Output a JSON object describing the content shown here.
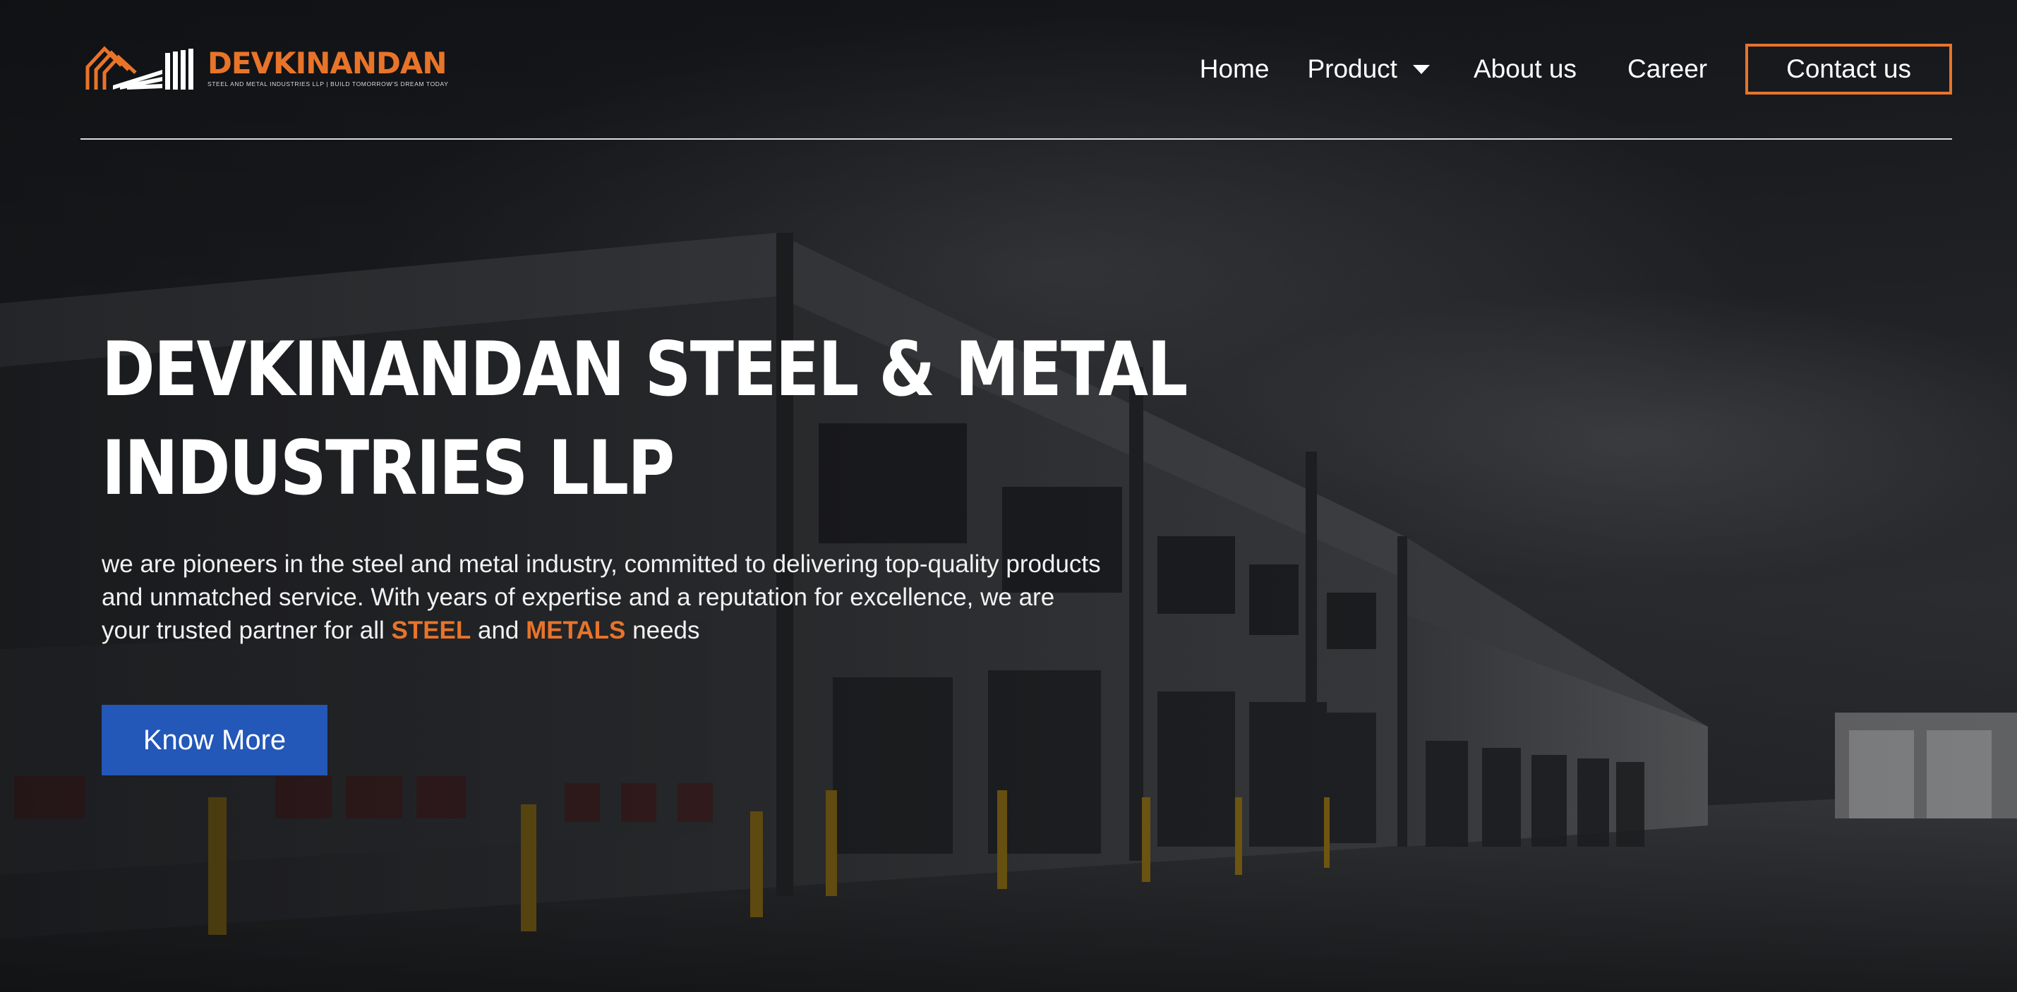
{
  "brand": {
    "name": "DEVKINANDAN",
    "tagline": "STEEL AND METAL INDUSTRIES LLP | BUILD TOMORROW'S DREAM TODAY",
    "accent_color": "#e8742a"
  },
  "nav": {
    "home": "Home",
    "product": "Product",
    "about": "About us",
    "career": "Career",
    "contact": "Contact us"
  },
  "hero": {
    "title_line1": "DEVKINANDAN STEEL & METAL",
    "title_line2": "INDUSTRIES LLP",
    "desc_part1": "we are pioneers in the steel and metal industry, committed to delivering top-quality products and unmatched service. With years of expertise and a reputation for excellence, we are your trusted partner for all ",
    "highlight1": "STEEL",
    "desc_part2": " and ",
    "highlight2": "METALS",
    "desc_part3": " needs",
    "button_label": "Know More",
    "button_color": "#2357b8",
    "background": "industrial-warehouse-photo"
  },
  "icons": {
    "dropdown": "caret-down-icon",
    "logo": "roof-building-logo"
  }
}
